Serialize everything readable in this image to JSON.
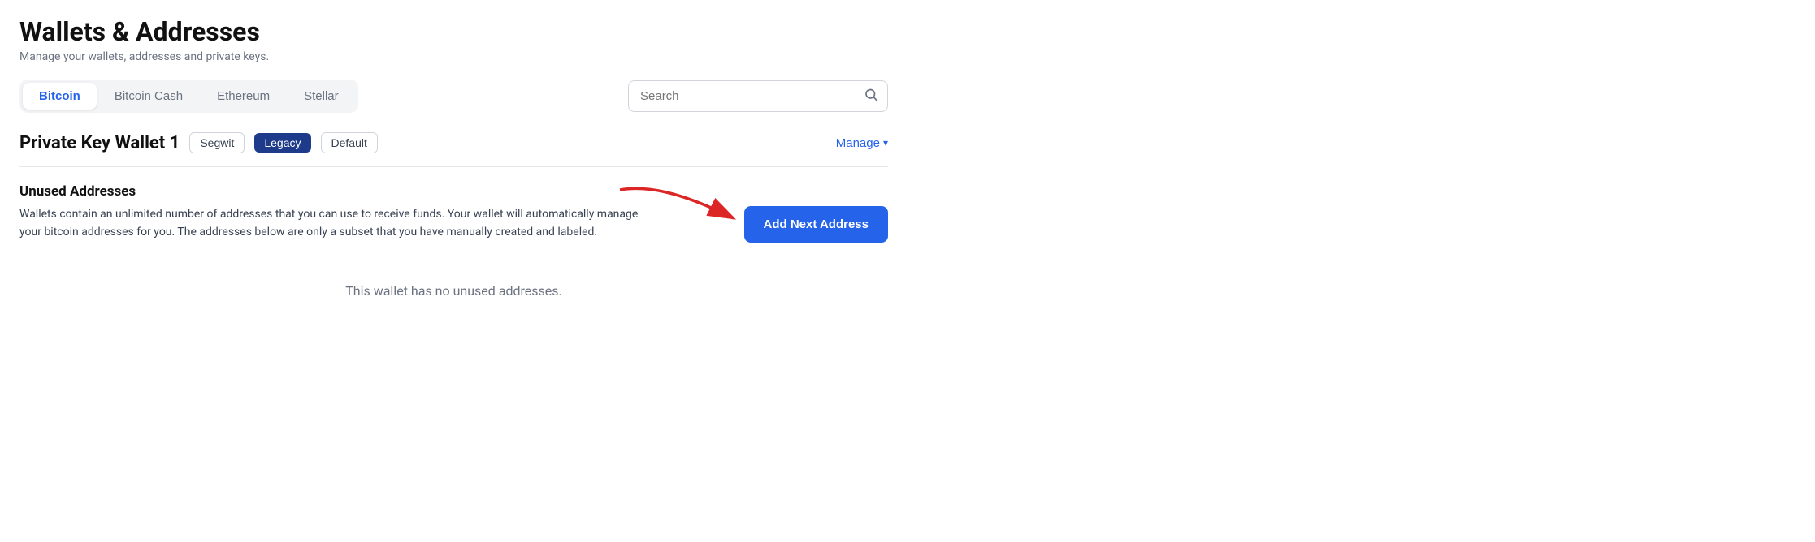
{
  "page": {
    "title": "Wallets & Addresses",
    "subtitle": "Manage your wallets, addresses and private keys."
  },
  "tabs": [
    {
      "id": "bitcoin",
      "label": "Bitcoin",
      "active": true
    },
    {
      "id": "bitcoin-cash",
      "label": "Bitcoin Cash",
      "active": false
    },
    {
      "id": "ethereum",
      "label": "Ethereum",
      "active": false
    },
    {
      "id": "stellar",
      "label": "Stellar",
      "active": false
    }
  ],
  "search": {
    "placeholder": "Search"
  },
  "wallet": {
    "name": "Private Key Wallet 1",
    "badges": [
      {
        "id": "segwit",
        "label": "Segwit",
        "style": "segwit"
      },
      {
        "id": "legacy",
        "label": "Legacy",
        "style": "legacy"
      },
      {
        "id": "default",
        "label": "Default",
        "style": "default"
      }
    ],
    "manage_label": "Manage"
  },
  "unused_section": {
    "title": "Unused Addresses",
    "description": "Wallets contain an unlimited number of addresses that you can use to receive funds. Your wallet will automatically manage your bitcoin addresses for you. The addresses below are only a subset that you have manually created and labeled.",
    "add_button_label": "Add Next Address",
    "empty_message": "This wallet has no unused addresses."
  }
}
